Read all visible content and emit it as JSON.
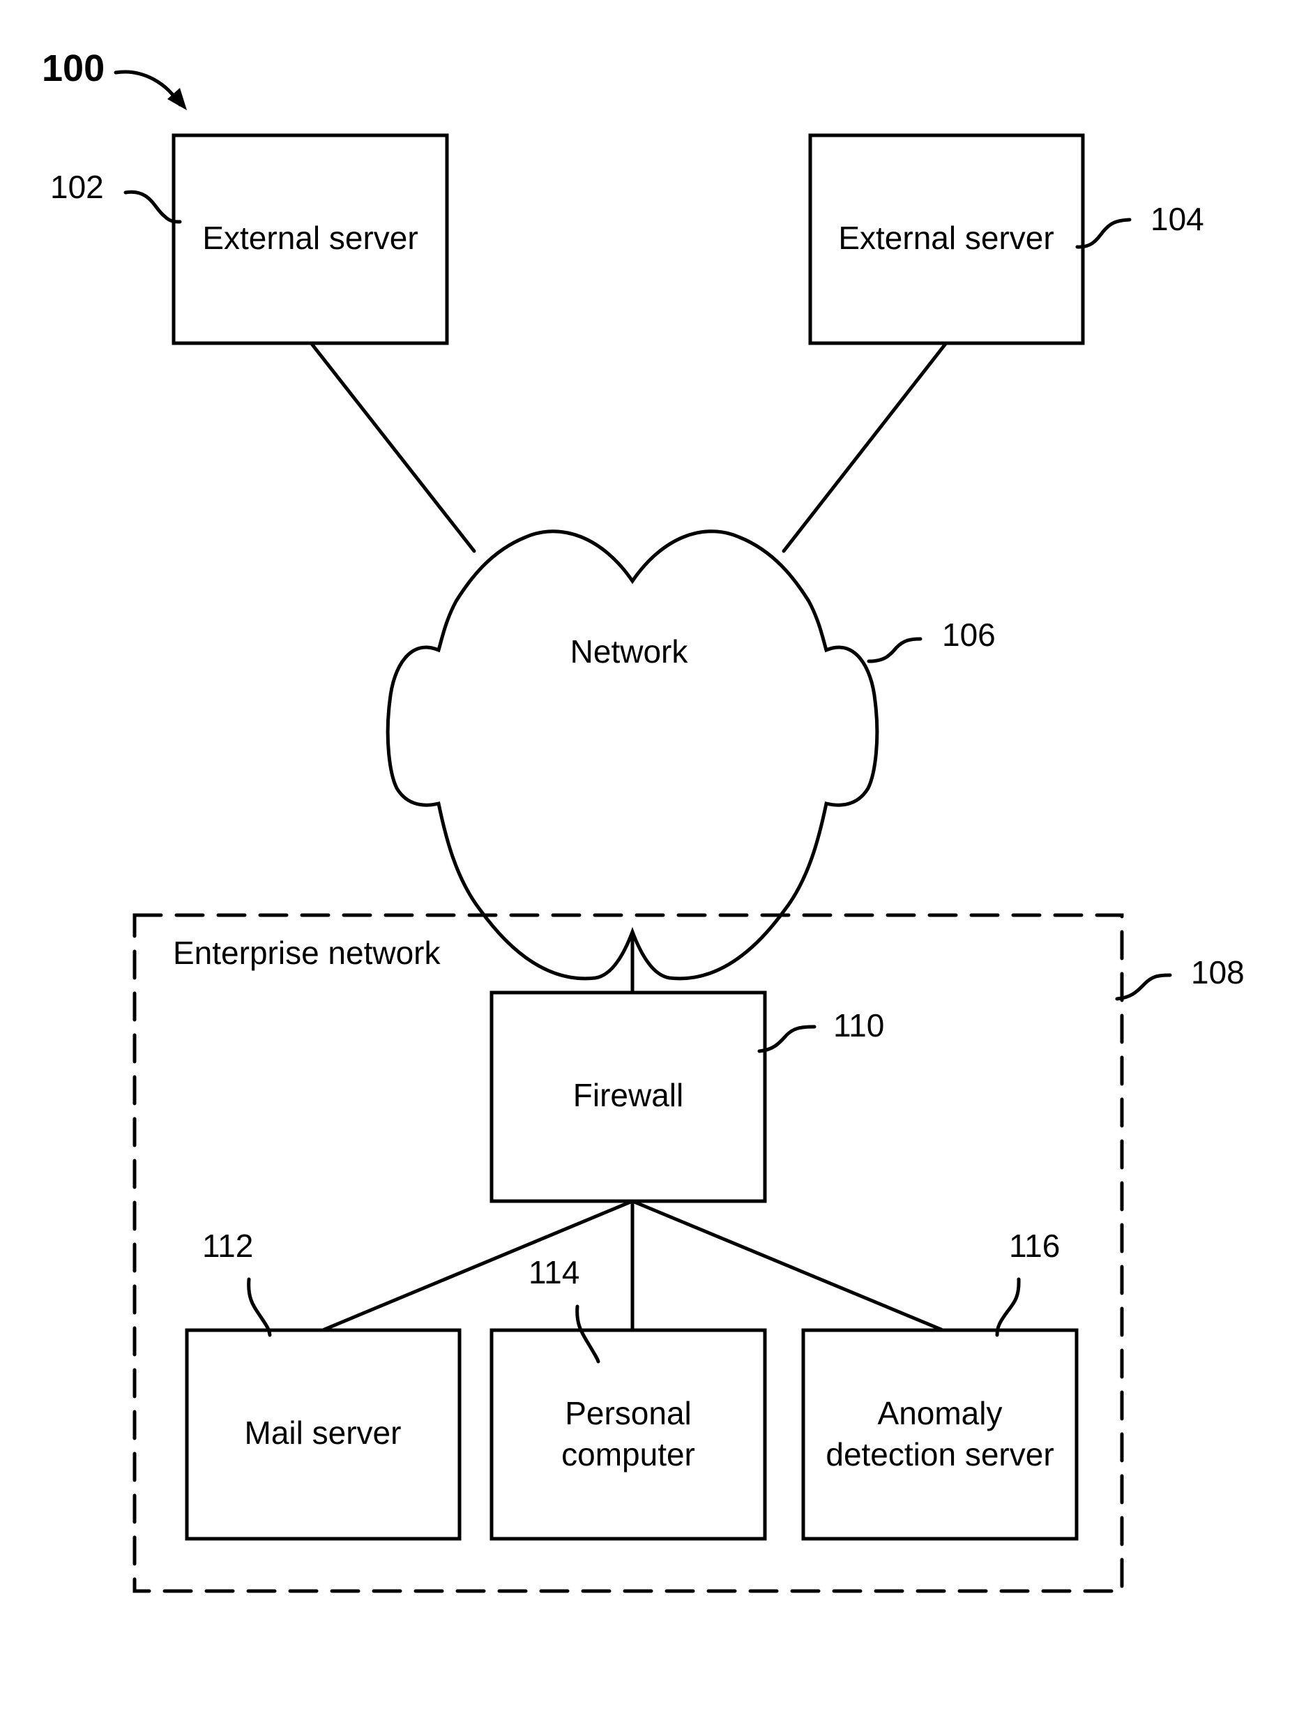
{
  "figure": {
    "number": "100",
    "nodes": {
      "external_server_1": {
        "label": "External server",
        "ref": "102"
      },
      "external_server_2": {
        "label": "External server",
        "ref": "104"
      },
      "network": {
        "label": "Network",
        "ref": "106"
      },
      "enterprise_network": {
        "label": "Enterprise network",
        "ref": "108"
      },
      "firewall": {
        "label": "Firewall",
        "ref": "110"
      },
      "mail_server": {
        "label": "Mail server",
        "ref": "112"
      },
      "personal_computer": {
        "label_line1": "Personal",
        "label_line2": "computer",
        "ref": "114"
      },
      "anomaly_server": {
        "label_line1": "Anomaly",
        "label_line2": "detection server",
        "ref": "116"
      }
    },
    "connections": [
      [
        "external_server_1",
        "network"
      ],
      [
        "external_server_2",
        "network"
      ],
      [
        "network",
        "firewall"
      ],
      [
        "firewall",
        "mail_server"
      ],
      [
        "firewall",
        "personal_computer"
      ],
      [
        "firewall",
        "anomaly_server"
      ]
    ]
  }
}
